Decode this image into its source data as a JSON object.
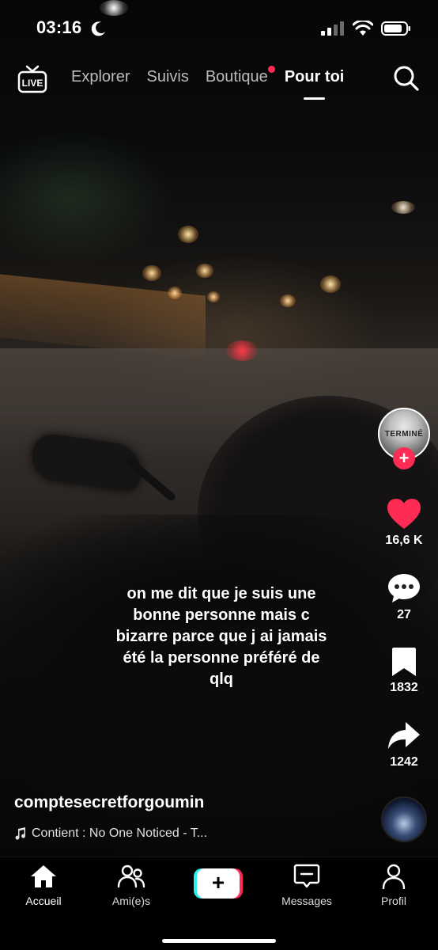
{
  "status_bar": {
    "time": "03:16"
  },
  "top_nav": {
    "live_label": "LIVE",
    "tabs": [
      {
        "label": "Explorer",
        "active": false,
        "notification_dot": false
      },
      {
        "label": "Suivis",
        "active": false,
        "notification_dot": false
      },
      {
        "label": "Boutique",
        "active": false,
        "notification_dot": true
      },
      {
        "label": "Pour toi",
        "active": true,
        "notification_dot": false
      }
    ]
  },
  "creator": {
    "avatar_text": "TERMINÉ",
    "username": "comptesecretforgoumin"
  },
  "actions": {
    "likes": "16,6 K",
    "comments": "27",
    "saves": "1832",
    "shares": "1242"
  },
  "caption": "on me dit que je suis une bonne personne mais c bizarre parce que j ai jamais été la personne préféré de qlq",
  "music": {
    "text": "Contient : No One Noticed - T..."
  },
  "bottom_nav": {
    "items": [
      {
        "label": "Accueil",
        "icon": "home-icon",
        "active": true
      },
      {
        "label": "Ami(e)s",
        "icon": "friends-icon",
        "active": false
      },
      {
        "label": "",
        "icon": "create-plus-icon",
        "active": false
      },
      {
        "label": "Messages",
        "icon": "inbox-icon",
        "active": false
      },
      {
        "label": "Profil",
        "icon": "profile-icon",
        "active": false
      }
    ]
  },
  "colors": {
    "accent": "#fe2c55",
    "cyan": "#25f4ee",
    "background": "#000000"
  }
}
